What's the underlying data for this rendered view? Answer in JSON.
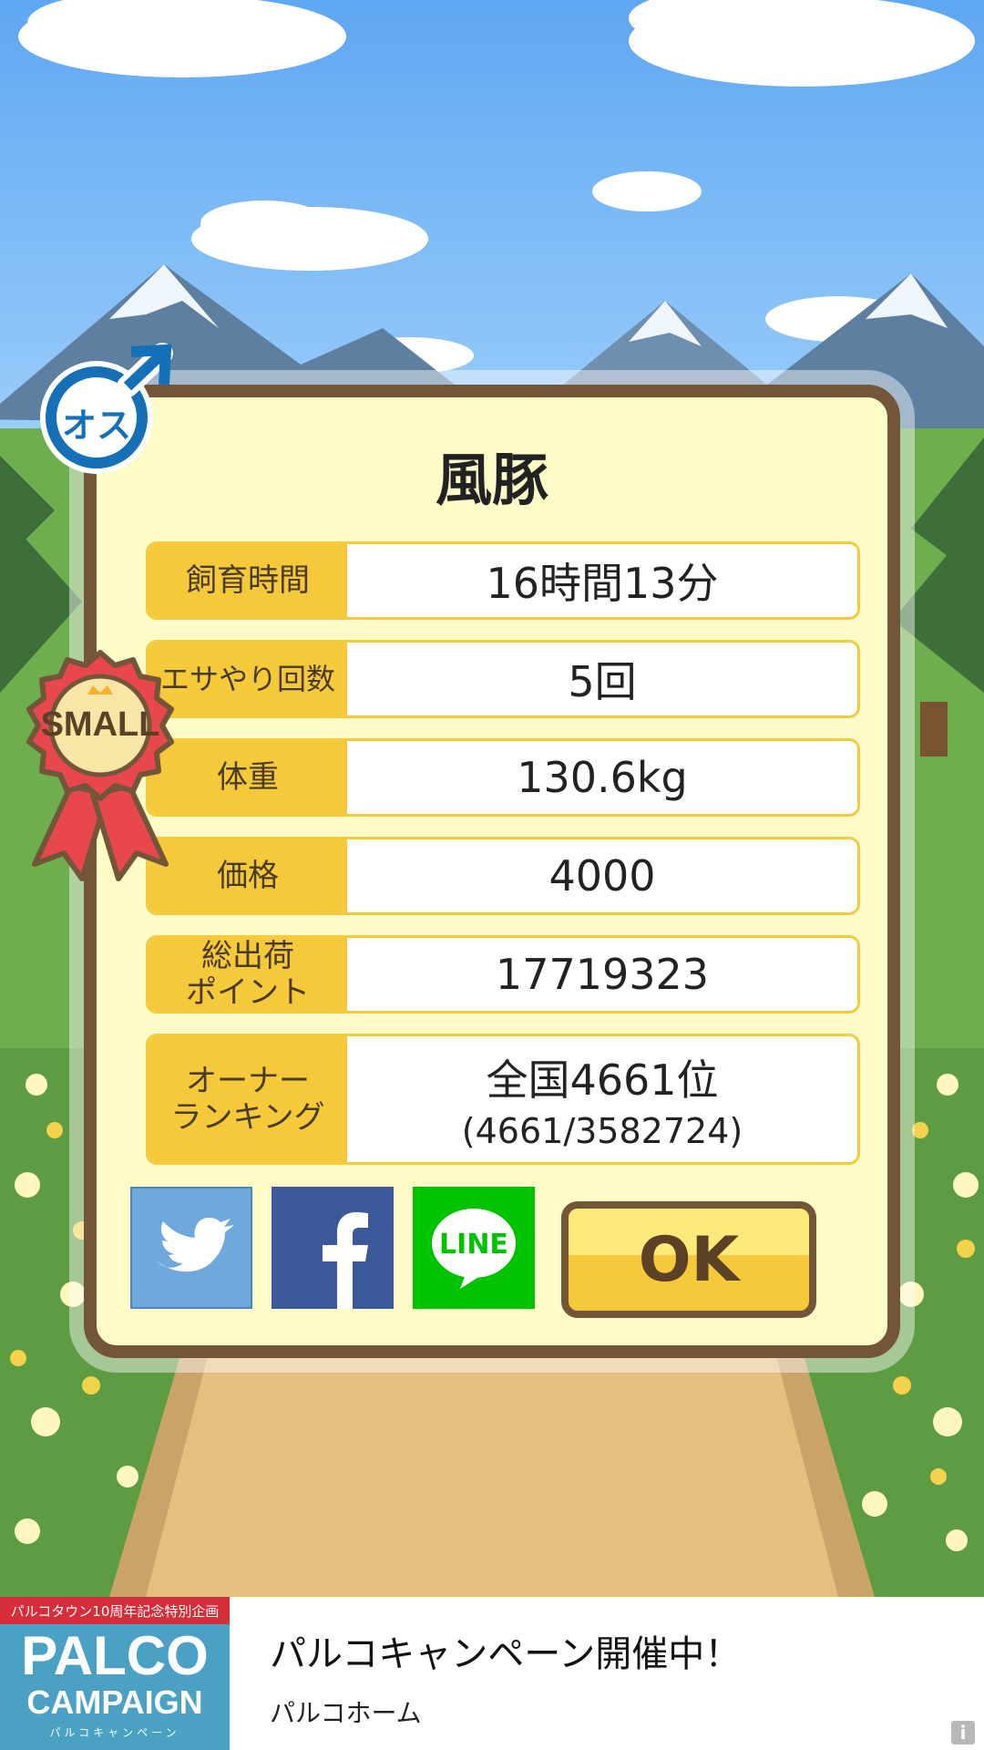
{
  "result": {
    "pig_name": "風豚",
    "gender_badge": "オス",
    "size_badge": "SMALL",
    "stats": [
      {
        "label": "飼育時間",
        "value": "16時間13分"
      },
      {
        "label": "エサやり回数",
        "value": "5回"
      },
      {
        "label": "体重",
        "value": "130.6kg"
      },
      {
        "label": "価格",
        "value": "4000"
      },
      {
        "label": "総出荷\nポイント",
        "value": "17719323"
      }
    ],
    "ranking": {
      "label": "オーナー\nランキング",
      "rank": "全国4661位",
      "detail": "(4661/3582724)"
    },
    "share": {
      "twitter_icon": "twitter-icon",
      "facebook_icon": "facebook-icon",
      "line_label": "LINE"
    },
    "ok_label": "OK"
  },
  "ad": {
    "ribbon": "パルコタウン10周年記念特別企画",
    "logo_line1": "PALCO",
    "logo_line2": "CAMPAIGN",
    "logo_line3": "パルコキャンペーン",
    "title": "パルコキャンペーン開催中！",
    "subtitle": "パルコホーム",
    "info_icon": "info-icon"
  }
}
